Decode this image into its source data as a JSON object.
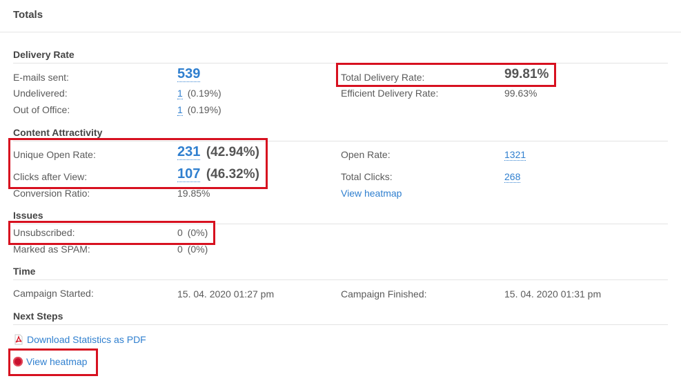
{
  "header": {
    "title": "Totals"
  },
  "sections": {
    "delivery": "Delivery Rate",
    "content": "Content Attractivity",
    "issues": "Issues",
    "time": "Time",
    "next": "Next Steps"
  },
  "delivery": {
    "emails_sent_label": "E-mails sent:",
    "emails_sent_value": "539",
    "undelivered_label": "Undelivered:",
    "undelivered_count": "1",
    "undelivered_pct": "(0.19%)",
    "ooo_label": "Out of Office:",
    "ooo_count": "1",
    "ooo_pct": "(0.19%)",
    "total_rate_label": "Total Delivery Rate:",
    "total_rate_value": "99.81%",
    "efficient_rate_label": "Efficient Delivery Rate:",
    "efficient_rate_value": "99.63%"
  },
  "content": {
    "unique_open_label": "Unique Open Rate:",
    "unique_open_count": "231",
    "unique_open_pct": "(42.94%)",
    "clicks_view_label": "Clicks after View:",
    "clicks_view_count": "107",
    "clicks_view_pct": "(46.32%)",
    "conversion_label": "Conversion Ratio:",
    "conversion_value": "19.85%",
    "open_rate_label": "Open Rate:",
    "open_rate_value": "1321",
    "total_clicks_label": "Total Clicks:",
    "total_clicks_value": "268",
    "view_heatmap": "View heatmap"
  },
  "issues": {
    "unsub_label": "Unsubscribed:",
    "unsub_value": "0",
    "unsub_pct": "(0%)",
    "spam_label": "Marked as SPAM:",
    "spam_value": "0",
    "spam_pct": "(0%)"
  },
  "time": {
    "started_label": "Campaign Started:",
    "started_value": "15. 04. 2020 01:27 pm",
    "finished_label": "Campaign Finished:",
    "finished_value": "15. 04. 2020 01:31 pm"
  },
  "next_steps": {
    "download_pdf": "Download Statistics as PDF",
    "view_heatmap": "View heatmap",
    "pdf_icon": "pdf-icon",
    "heatmap_icon": "heatmap-icon"
  },
  "colors": {
    "link": "#2f7fcf",
    "highlight": "#d7101f"
  }
}
